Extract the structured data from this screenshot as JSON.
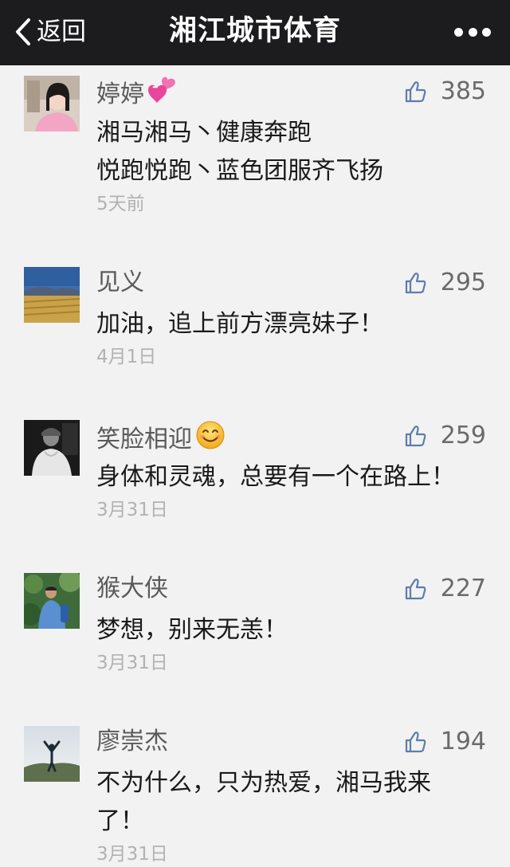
{
  "header": {
    "back_label": "返回",
    "title": "湘江城市体育"
  },
  "comments": [
    {
      "name": "婷婷",
      "emoji": "two-hearts",
      "likes": "385",
      "lines": [
        "湘马湘马丶健康奔跑",
        "悦跑悦跑丶蓝色团服齐飞扬"
      ],
      "date": "5天前"
    },
    {
      "name": "见义",
      "likes": "295",
      "lines": [
        "加油，追上前方漂亮妹子！"
      ],
      "date": "4月1日"
    },
    {
      "name": "笑脸相迎",
      "emoji": "smiling-face",
      "likes": "259",
      "lines": [
        "身体和灵魂，总要有一个在路上！"
      ],
      "date": "3月31日"
    },
    {
      "name": "猴大侠",
      "likes": "227",
      "lines": [
        "梦想，别来无恙！"
      ],
      "date": "3月31日"
    },
    {
      "name": "廖崇杰",
      "likes": "194",
      "lines": [
        "不为什么，只为热爱，湘马我来",
        "了！"
      ],
      "date": "3月31日"
    }
  ]
}
